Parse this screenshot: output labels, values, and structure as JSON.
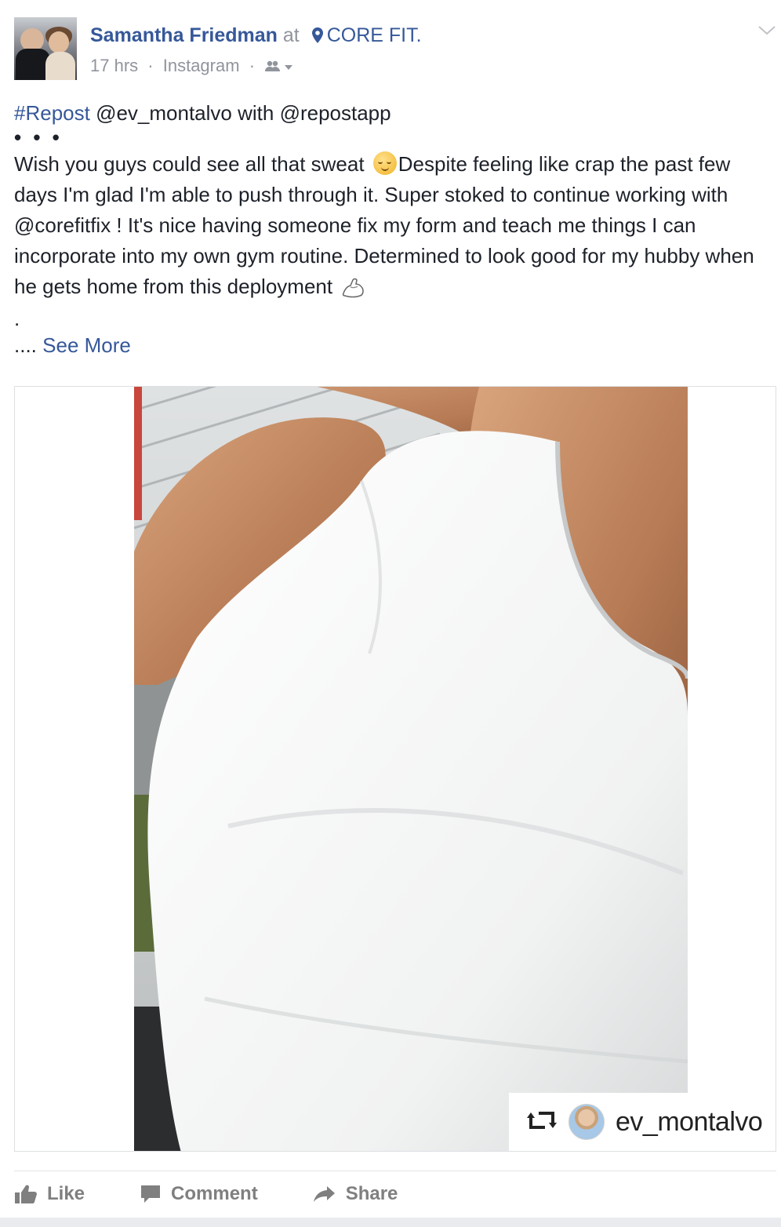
{
  "post": {
    "author": "Samantha Friedman",
    "at_text": "at",
    "place": "CORE FIT.",
    "time": "17 hrs",
    "source": "Instagram",
    "separator": "·",
    "audience_icon": "friends-icon",
    "caption": {
      "line1_hashtag": "#Repost",
      "line1_rest": " @ev_montalvo with @repostapp",
      "dots": "• • •",
      "body_part1": "Wish you guys could see all that sweat ",
      "body_part2": "Despite feeling like crap the past few days I'm glad I'm able to push through it. Super stoked to continue working with @corefitfix ! It's nice having someone fix my form and teach me things I can incorporate into my own gym routine. Determined to look good for my hubby when he gets home from this deployment ",
      "period": ".",
      "ellipsis": "....",
      "see_more": "See More"
    },
    "photo": {
      "repost_username": "ev_montalvo"
    },
    "actions": {
      "like": "Like",
      "comment": "Comment",
      "share": "Share"
    },
    "colors": {
      "link": "#365899",
      "meta": "#90949c",
      "action": "#7f7f7f"
    }
  }
}
